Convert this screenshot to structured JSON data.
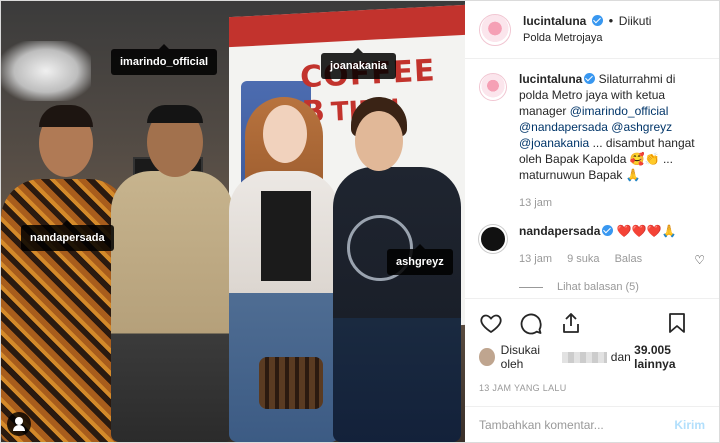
{
  "photo": {
    "banner_line1": "COFFEE B",
    "banner_line2": "TIBN",
    "tags": [
      "imarindo_official",
      "joanakania",
      "nandapersada",
      "ashgreyz"
    ]
  },
  "header": {
    "username": "lucintaluna",
    "separator": "•",
    "follow_status": "Diikuti",
    "location": "Polda Metrojaya"
  },
  "caption": {
    "username": "lucintaluna",
    "text_before": " Silaturrahmi di polda Metro jaya with ketua manager ",
    "mention1": "@imarindo_official",
    "mention2": "@nandapersada",
    "mention3": "@ashgreyz",
    "mention4": "@joanakania",
    "text_after": " ... disambut hangat oleh Bapak Kapolda 🥰👏 ... maturnuwun Bapak 🙏",
    "time": "13 jam"
  },
  "comment": {
    "username": "nandapersada",
    "text": " ❤️❤️❤️🙏",
    "time": "13 jam",
    "likes": "9 suka",
    "reply": "Balas",
    "view_replies": "Lihat balasan (5)"
  },
  "actions": {
    "liked_by_prefix": "Disukai oleh",
    "liked_by_suffix_and": "dan",
    "like_count": "39.005 lainnya",
    "posted_time": "13 JAM YANG LALU"
  },
  "add_comment": {
    "placeholder": "Tambahkan komentar...",
    "send_label": "Kirim"
  },
  "colors": {
    "mention": "#003569",
    "verified": "#3897f0",
    "send_disabled": "#b2dffc"
  }
}
